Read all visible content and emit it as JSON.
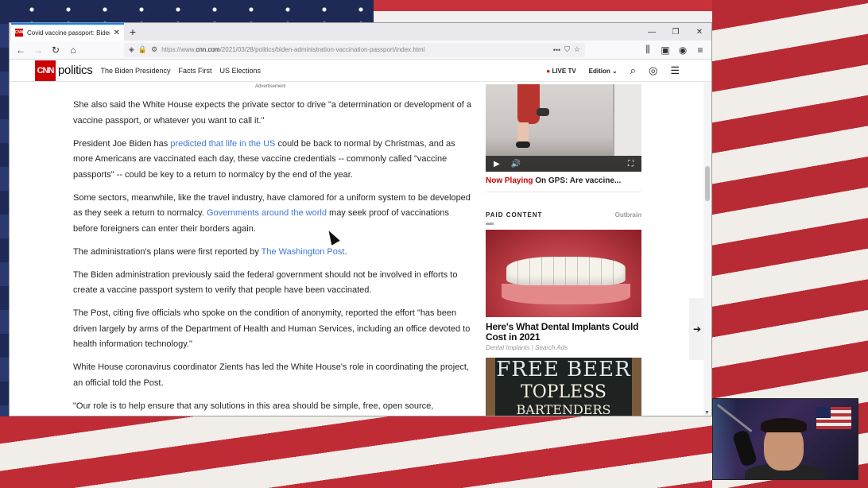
{
  "browser": {
    "tab_title": "Covid vaccine passport: Biden ...",
    "favicon": "CNN",
    "url_prefix": "https://www.",
    "url_domain": "cnn.com",
    "url_path": "/2021/03/28/politics/biden-administration-vaccination-passport/index.html",
    "new_tab": "+",
    "win_min": "—",
    "win_max": "❐",
    "win_close": "✕"
  },
  "cnn": {
    "logo": "CNN",
    "section": "politics",
    "nav_links": [
      "The Biden Presidency",
      "Facts First",
      "US Elections"
    ],
    "live_tv": "LIVE TV",
    "edition": "Edition"
  },
  "advert_label": "Advertisement",
  "article": {
    "p1": "She also said the White House expects the private sector to drive \"a determination or development of a vaccine passport, or whatever you want to call it.\"",
    "p2_pre": "President Joe Biden has ",
    "p2_link": "predicted that life in the US",
    "p2_post": " could be back to normal by Christmas, and as more Americans are vaccinated each day, these vaccine credentials -- commonly called \"vaccine passports\" -- could be key to a return to normalcy by the end of the year.",
    "p3_pre": "Some sectors, meanwhile, like the travel industry, have clamored for a uniform system to be developed as they seek a return to normalcy. ",
    "p3_link": "Governments around the world",
    "p3_post": " may seek proof of vaccinations before foreigners can enter their borders again.",
    "p4_pre": "The administration's plans were first reported by ",
    "p4_link": "The Washington Post",
    "p4_post": ".",
    "p5": "The Biden administration previously said the federal government should not be involved in efforts to create a vaccine passport system to verify that people have been vaccinated.",
    "p6": "The Post, citing five officials who spoke on the condition of anonymity, reported the effort \"has been driven largely by arms of the Department of Health and Human Services, including an office devoted to health information technology.\"",
    "p7": "White House coronavirus coordinator Zients has led the White House's role in coordinating the project, an official told the Post.",
    "p8": "\"Our role is to help ensure that any solutions in this area should be simple, free, open source,"
  },
  "sidebar": {
    "now_playing_label": "Now Playing",
    "now_playing_title": " On GPS: Are vaccine...",
    "paid_content": "PAID CONTENT",
    "outbrain": "Outbrain",
    "ad1_title": "Here's What Dental Implants Could Cost in 2021",
    "ad1_source": "Dental Implants | Search Ads",
    "ad2_line1": "FREE BEER",
    "ad2_line2": "TOPLESS",
    "ad2_line3": "BARTENDERS"
  }
}
